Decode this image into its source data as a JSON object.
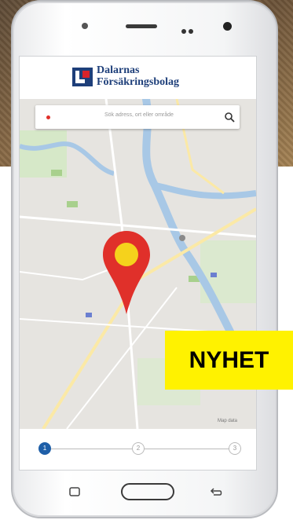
{
  "brand": {
    "line1": "Dalarnas",
    "line2": "Försäkringsbolag",
    "color": "#1e3f7a",
    "accent": "#d8232a"
  },
  "search": {
    "placeholder": "Sök adress, ort eller område"
  },
  "map": {
    "pin_color": "#e0302a",
    "pin_center_color": "#f5d21c",
    "credit": "Map data"
  },
  "stepper": {
    "steps": [
      "1",
      "2",
      "3"
    ],
    "current_step": 1,
    "progress": 0.0,
    "accent": "#1e5fa8"
  },
  "badge": {
    "text": "NYHET",
    "color": "#fff200"
  },
  "icons": {
    "search": "search-icon",
    "location": "location-pin-icon",
    "back": "back-icon",
    "recent": "recent-apps-icon"
  }
}
